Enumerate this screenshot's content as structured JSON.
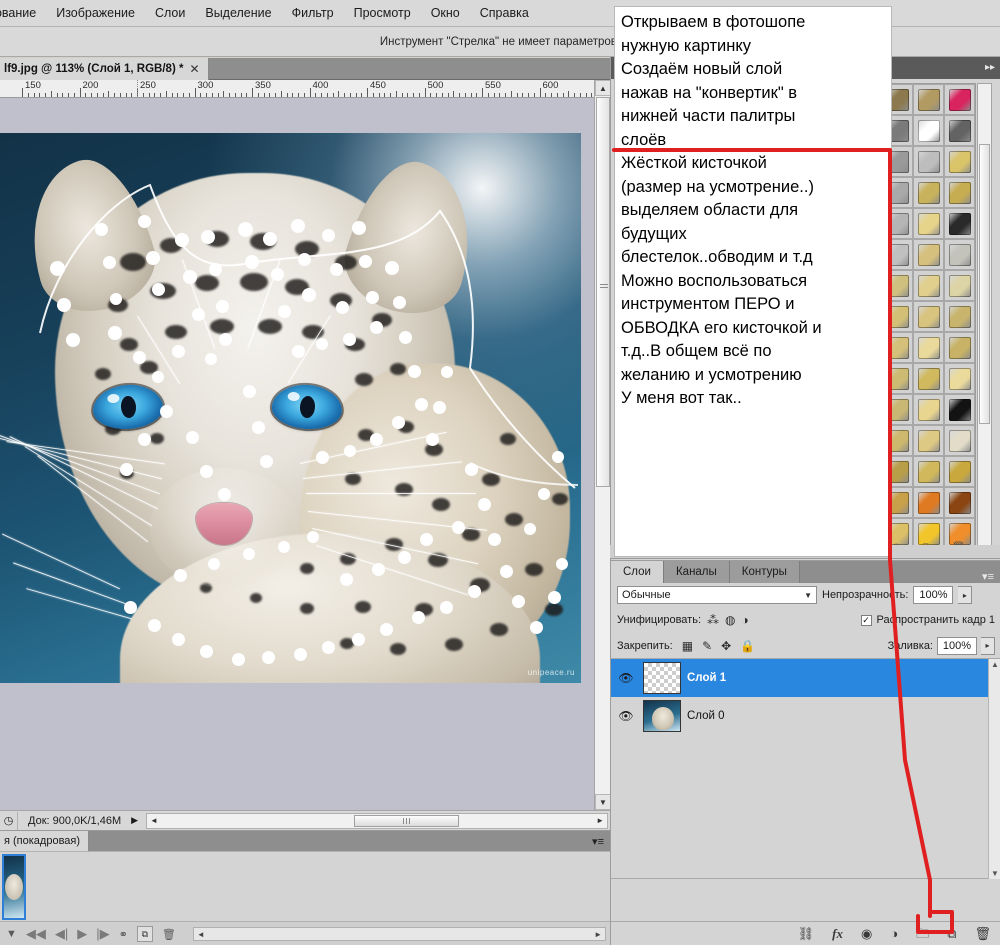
{
  "app": {
    "menubar": [
      {
        "label": "рование"
      },
      {
        "label": "Изображение"
      },
      {
        "label": "Слои"
      },
      {
        "label": "Выделение"
      },
      {
        "label": "Фильтр"
      },
      {
        "label": "Просмотр"
      },
      {
        "label": "Окно"
      },
      {
        "label": "Справка"
      }
    ],
    "options_hint": "Инструмент \"Стрелка\" не имеет параметров.",
    "document_tab": {
      "title": "lf9.jpg @ 113% (Слой 1, RGB/8) *",
      "close": "✕"
    }
  },
  "ruler": {
    "labels": [
      "150",
      "200",
      "250",
      "300",
      "350",
      "400",
      "450",
      "500",
      "550",
      "600"
    ],
    "unit_start": 150,
    "unit_step": 50
  },
  "canvas": {
    "watermark": "unipeace.ru",
    "zoom": "113%"
  },
  "status": {
    "clock_icon": "clock-icon",
    "doc_label": "Док: 900,0K/1,46M",
    "expand_arrow": "▶",
    "scroll_left": "◄",
    "scroll_right": "►"
  },
  "animation": {
    "tab_label": "я (покадровая)",
    "panel_menu_icon": "panel-menu-icon",
    "controls": [
      {
        "name": "loop-dropdown",
        "glyph": "▼"
      },
      {
        "name": "first-frame",
        "glyph": "◀◀"
      },
      {
        "name": "prev-frame",
        "glyph": "◀|"
      },
      {
        "name": "play",
        "glyph": "▶"
      },
      {
        "name": "next-frame",
        "glyph": "|▶"
      },
      {
        "name": "tween",
        "glyph": "⚭"
      },
      {
        "name": "duplicate-frame",
        "glyph": "⧉"
      },
      {
        "name": "delete-frame",
        "glyph": "🗑"
      }
    ]
  },
  "styles_panel": {
    "collapse_icon": "collapse-icon",
    "footer": [
      {
        "name": "clear-style-button",
        "glyph": "⊘"
      },
      {
        "name": "new-style-button",
        "glyph": "⧉"
      },
      {
        "name": "delete-style-button",
        "glyph": "🗑"
      }
    ],
    "swatch_colors": [
      "#8c7a4e",
      "#b29b62",
      "#d8245f",
      "#7a7a7a",
      "#ffffff",
      "#636363",
      "#9a9a9a",
      "#bdbdbd",
      "#d9c46a",
      "#a9a9a9",
      "#c9b25c",
      "#c6ad52",
      "#b5b5b5",
      "#e6d48a",
      "#2a2a2a",
      "#c0c0c0",
      "#d6c07e",
      "#c3c3bb",
      "#cfc07f",
      "#e0cf8d",
      "#ddd4a6",
      "#d3bf76",
      "#d8c37f",
      "#c8b46d",
      "#d4c079",
      "#e9d99a",
      "#c7b265",
      "#cdbb74",
      "#d0b95f",
      "#eadb9c",
      "#c9b873",
      "#e8d58f",
      "#131313",
      "#cdb86d",
      "#ddc884",
      "#e2dcc8",
      "#b99e4a",
      "#d1b85c",
      "#c9a93d",
      "#c9a04a",
      "#e07a22",
      "#8a4512",
      "#dcc067",
      "#f2c62a",
      "#ef8e2a",
      "#a7a13d",
      "#5e6b18",
      "#efe4c4"
    ]
  },
  "tooltip": {
    "lines": [
      "Открываем в фотошопе",
      "нужную картинку",
      "Создаём новый слой",
      "нажав на \"конвертик\" в",
      "нижней части палитры",
      "слоёв",
      "Жёсткой кисточкой",
      "(размер на усмотрение..)",
      "выделяем области для",
      "будущих",
      "блестелок..обводим и т.д",
      "Можно воспользоваться",
      "инструментом ПЕРО и",
      "ОБВОДКА его кисточкой и",
      "т.д..В общем всё по",
      "желанию и усмотрению",
      "У меня вот так.."
    ]
  },
  "annotation": {
    "color": "#e02020",
    "description": "red-pointer-line"
  },
  "layers_panel": {
    "tabs": [
      {
        "label": "Слои",
        "active": true
      },
      {
        "label": "Каналы",
        "active": false
      },
      {
        "label": "Контуры",
        "active": false
      }
    ],
    "panel_menu_icon": "panel-menu-icon",
    "blend_mode": "Обычные",
    "blend_caret": "▼",
    "opacity_label": "Непрозрачность:",
    "opacity_value": "100%",
    "unify_label": "Унифицировать:",
    "unify_icons": [
      "unify-position-icon",
      "unify-visibility-icon",
      "unify-style-icon"
    ],
    "propagate_checked": "✓",
    "propagate_label": "Распространить кадр 1",
    "lock_label": "Закрепить:",
    "lock_icons": [
      "lock-transparency-icon",
      "lock-paint-icon",
      "lock-move-icon",
      "lock-all-icon"
    ],
    "fill_label": "Заливка:",
    "fill_value": "100%",
    "layers": [
      {
        "name": "Слой 1",
        "visible": "👁",
        "selected": true,
        "thumb": "transparent"
      },
      {
        "name": "Слой 0",
        "visible": "👁",
        "selected": false,
        "thumb": "image"
      }
    ],
    "footer_buttons": [
      {
        "name": "link-layers-button",
        "glyph": "⛓"
      },
      {
        "name": "layer-style-button",
        "glyph": "fx"
      },
      {
        "name": "layer-mask-button",
        "glyph": "◉"
      },
      {
        "name": "adjustment-layer-button",
        "glyph": "◑"
      },
      {
        "name": "new-group-button",
        "glyph": "🗀"
      },
      {
        "name": "new-layer-button",
        "glyph": "⧉"
      },
      {
        "name": "delete-layer-button",
        "glyph": "🗑"
      }
    ]
  }
}
